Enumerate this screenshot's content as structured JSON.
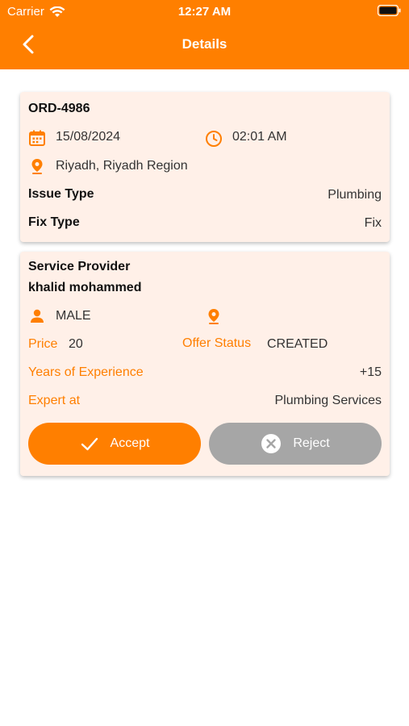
{
  "status_bar": {
    "carrier": "Carrier",
    "time": "12:27 AM"
  },
  "nav": {
    "title": "Details"
  },
  "colors": {
    "accent": "#FF7F00",
    "card_bg": "#FFF0E8",
    "reject_gray": "#A6A6A6"
  },
  "order": {
    "id": "ORD-4986",
    "date": "15/08/2024",
    "time": "02:01 AM",
    "location": "Riyadh, Riyadh Region",
    "issue_type_label": "Issue Type",
    "issue_type_value": "Plumbing",
    "fix_type_label": "Fix Type",
    "fix_type_value": "Fix"
  },
  "provider": {
    "heading": "Service Provider",
    "name": "khalid mohammed",
    "gender": "MALE",
    "price_label": "Price",
    "price_value": "20",
    "offer_status_label": "Offer Status",
    "offer_status_value": "CREATED",
    "experience_label": "Years of Experience",
    "experience_value": "+15",
    "expert_label": "Expert at",
    "expert_value": "Plumbing Services"
  },
  "actions": {
    "accept_label": "Accept",
    "reject_label": "Reject"
  },
  "icons": {
    "back": "chevron-left-icon",
    "calendar": "calendar-icon",
    "clock": "clock-icon",
    "location": "location-pin-icon",
    "person": "person-icon",
    "check": "check-icon",
    "close": "close-circle-icon",
    "wifi": "wifi-icon",
    "battery": "battery-icon"
  }
}
